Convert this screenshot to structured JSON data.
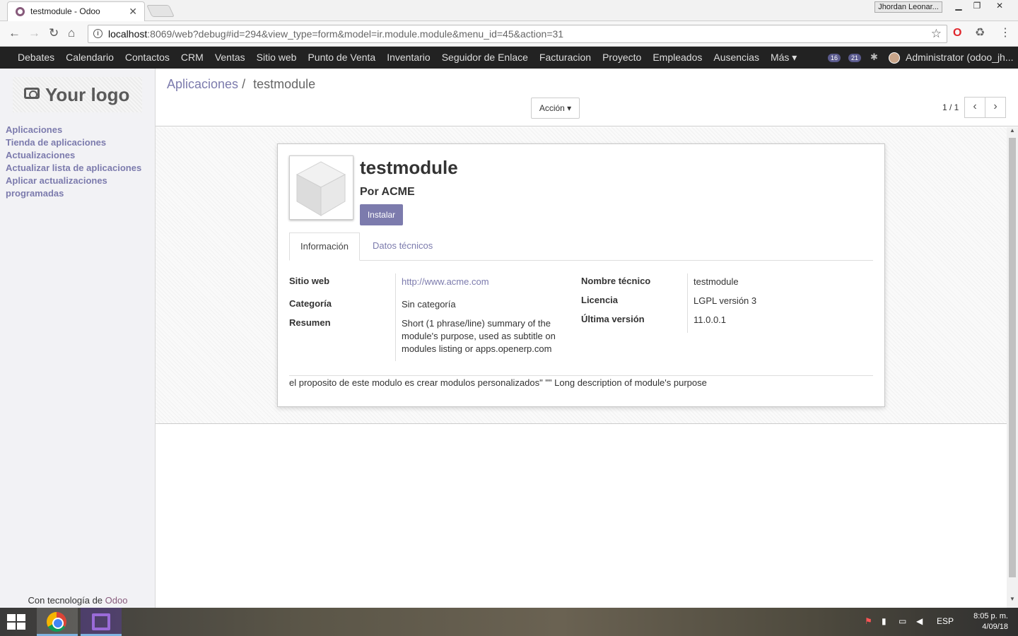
{
  "browser": {
    "tab_title": "testmodule - Odoo",
    "tab_close": "✕",
    "profile_name": "Jhordan Leonar...",
    "url_host": "localhost",
    "url_rest": ":8069/web?debug#id=294&view_type=form&model=ir.module.module&menu_id=45&action=31"
  },
  "topnav": {
    "items": [
      "Debates",
      "Calendario",
      "Contactos",
      "CRM",
      "Ventas",
      "Sitio web",
      "Punto de Venta",
      "Inventario",
      "Seguidor de Enlace",
      "Facturacion",
      "Proyecto",
      "Empleados",
      "Ausencias",
      "Más ▾"
    ],
    "activity_count": "16",
    "messages_count": "21",
    "user": "Administrator (odoo_jh..."
  },
  "sidebar": {
    "logo_text": "Your logo",
    "menu": [
      "Aplicaciones",
      "Tienda de aplicaciones",
      "Actualizaciones",
      "Actualizar lista de aplicaciones",
      "Aplicar actualizaciones programadas"
    ],
    "powered_prefix": "Con tecnología de ",
    "powered_brand": "Odoo"
  },
  "control_panel": {
    "breadcrumb_parent": "Aplicaciones",
    "breadcrumb_sep": "/",
    "breadcrumb_current": "testmodule",
    "action_label": "Acción ▾",
    "pager": "1 / 1"
  },
  "form": {
    "name": "testmodule",
    "author": "Por ACME",
    "install_label": "Instalar",
    "tabs": [
      "Información",
      "Datos técnicos"
    ],
    "left_fields": [
      {
        "label": "Sitio web",
        "value": "http://www.acme.com"
      },
      {
        "label": "Categoría",
        "value": "Sin categoría"
      },
      {
        "label": "Resumen",
        "value": "Short (1 phrase/line) summary of the module's purpose, used as subtitle on modules listing or apps.openerp.com"
      }
    ],
    "right_fields": [
      {
        "label": "Nombre técnico",
        "value": "testmodule"
      },
      {
        "label": "Licencia",
        "value": "LGPL versión 3"
      },
      {
        "label": "Última versión",
        "value": "11.0.0.1"
      }
    ],
    "description": "el proposito de este modulo es crear modulos personalizados\" \"\" Long description of module's purpose"
  },
  "taskbar": {
    "language": "ESP",
    "time": "8:05 p. m.",
    "date": "4/09/18"
  },
  "colors": {
    "odoo_purple": "#7c7bad",
    "navbar": "#222222",
    "brand": "#875a7b"
  }
}
